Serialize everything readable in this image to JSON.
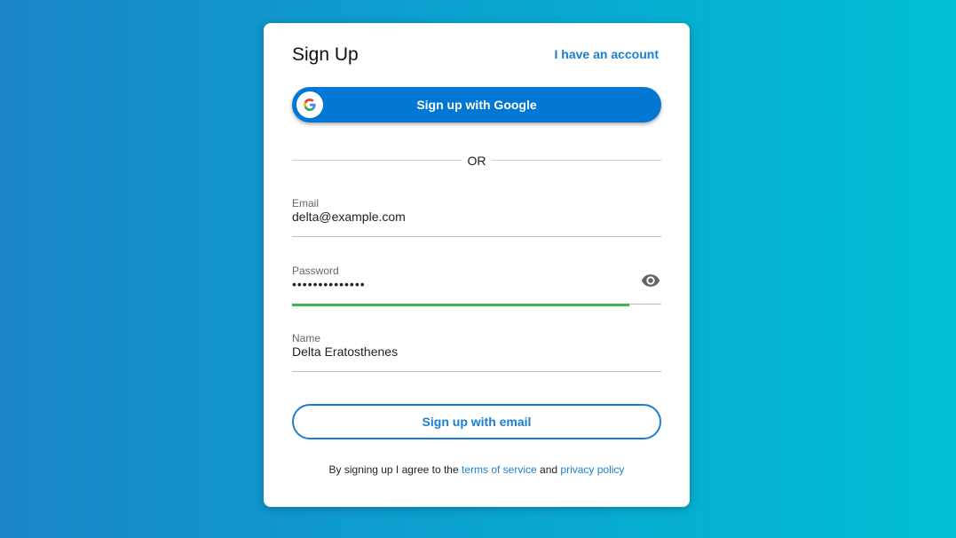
{
  "card": {
    "title": "Sign Up",
    "login_link": "I have an account"
  },
  "google_button": {
    "label": "Sign up with Google",
    "icon": "google-g-icon"
  },
  "divider": {
    "text": "OR"
  },
  "fields": {
    "email": {
      "label": "Email",
      "value": "delta@example.com"
    },
    "password": {
      "label": "Password",
      "value": "••••••••••••••",
      "strength": 0.913,
      "strength_color": "#3cb54a",
      "toggle_icon": "eye-icon"
    },
    "name": {
      "label": "Name",
      "value": "Delta Eratosthenes"
    }
  },
  "email_button": {
    "label": "Sign up with email"
  },
  "terms": {
    "prefix": "By signing up I agree to the",
    "tos": "terms of service",
    "and": "and",
    "privacy": "privacy policy"
  },
  "colors": {
    "primary": "#0278d4",
    "link": "#1a7fd0",
    "success": "#3cb54a"
  }
}
